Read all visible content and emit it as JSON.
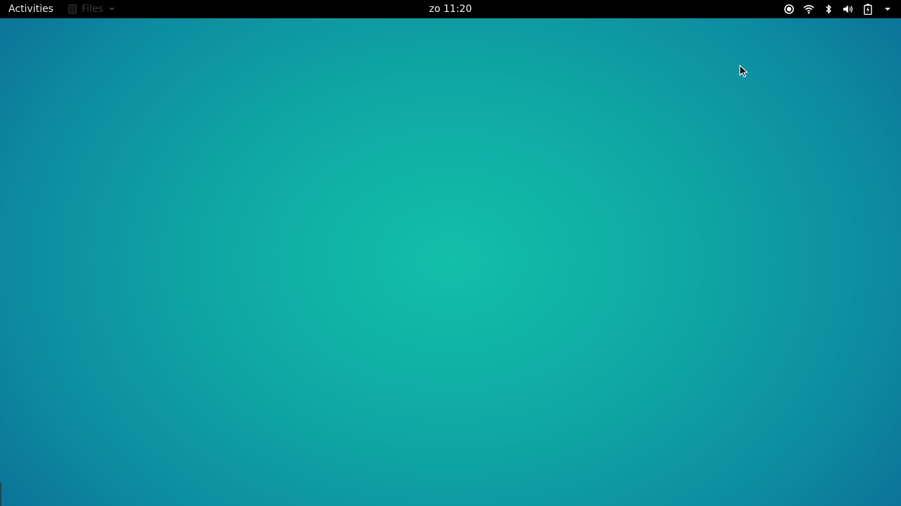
{
  "topbar": {
    "activities_label": "Activities",
    "app_menu": {
      "label": "Files",
      "icon": "files-icon"
    },
    "clock": "zo 11:20",
    "tray": [
      {
        "icon": "screen-record-icon"
      },
      {
        "icon": "wifi-icon"
      },
      {
        "icon": "bluetooth-icon"
      },
      {
        "icon": "volume-icon"
      },
      {
        "icon": "battery-charging-icon"
      },
      {
        "icon": "system-menu-arrow-icon"
      }
    ]
  },
  "colors": {
    "topbar_bg": "#000000",
    "desktop_center": "#12bfa8",
    "desktop_edge": "#0b6f96",
    "app_menu_text": "#3b3b3b"
  }
}
